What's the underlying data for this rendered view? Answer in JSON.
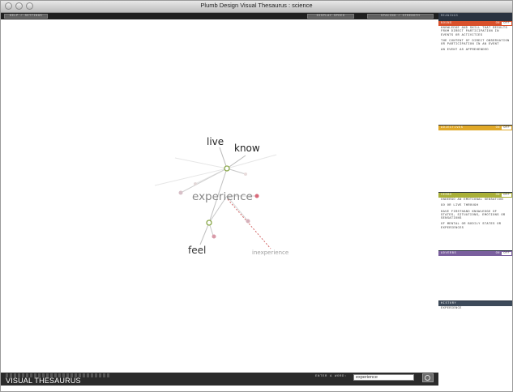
{
  "window": {
    "title": "Plumb Design Visual Thesaurus : science"
  },
  "toolbar": {
    "help": "HELP / SETTINGS",
    "display": "DISPLAY SPEED",
    "spacing": "SPACING / STRENGTH"
  },
  "graph": {
    "center": "experience",
    "labels": {
      "live": "live",
      "know": "know",
      "feel": "feel",
      "inexperience": "inexperience"
    }
  },
  "bottom": {
    "logo": "VISUAL THESAURUS",
    "enter_label": "ENTER A WORD:",
    "input_value": "experience"
  },
  "sidebar": {
    "top_label": "MEANINGS",
    "on_off": {
      "on": "ON",
      "off": "OFF"
    },
    "nouns": {
      "name": "NOUNS",
      "color": "#d9512c",
      "defs": [
        "KNOWLEDGE AND SKILL THAT RESULTS FROM DIRECT PARTICIPATION IN EVENTS OR ACTIVITIES",
        "THE CONTENT OF DIRECT OBSERVATION OR PARTICIPATION IN AN EVENT",
        "AN EVENT AS APPREHENDED"
      ]
    },
    "adjectives": {
      "name": "ADJECTIVES",
      "color": "#e0a828",
      "defs": []
    },
    "verbs": {
      "name": "VERBS",
      "color": "#a9b038",
      "defs": [
        "UNDERGO AN EMOTIONAL SENSATION",
        "GO OR LIVE THROUGH",
        "HAVE FIRSTHAND KNOWLEDGE OF STATES, SITUATIONS, EMOTIONS OR SENSATIONS",
        "OF MENTAL OR BODILY STATES OR EXPERIENCES"
      ]
    },
    "adverbs": {
      "name": "ADVERBS",
      "color": "#7a5f9e",
      "defs": []
    },
    "history": {
      "name": "HISTORY",
      "items": [
        "EXPERIENCE"
      ]
    }
  }
}
